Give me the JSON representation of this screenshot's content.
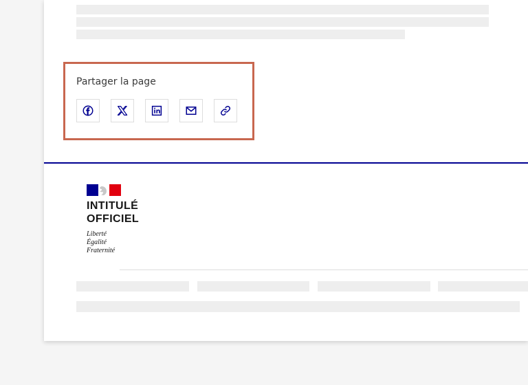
{
  "share": {
    "title": "Partager la page",
    "buttons": [
      {
        "id": "facebook",
        "icon": "facebook-icon"
      },
      {
        "id": "x",
        "icon": "x-icon"
      },
      {
        "id": "linkedin",
        "icon": "linkedin-icon"
      },
      {
        "id": "email",
        "icon": "mail-icon"
      },
      {
        "id": "copy-link",
        "icon": "link-icon"
      }
    ]
  },
  "brand": {
    "title_line1": "INTITULÉ",
    "title_line2": "OFFICIEL",
    "motto": [
      "Liberté",
      "Égalité",
      "Fraternité"
    ]
  },
  "colors": {
    "accent_blue": "#000091",
    "highlight_border": "#c8674f",
    "flag_blue": "#000091",
    "flag_red": "#e1000f",
    "skeleton": "#eeeeee"
  }
}
